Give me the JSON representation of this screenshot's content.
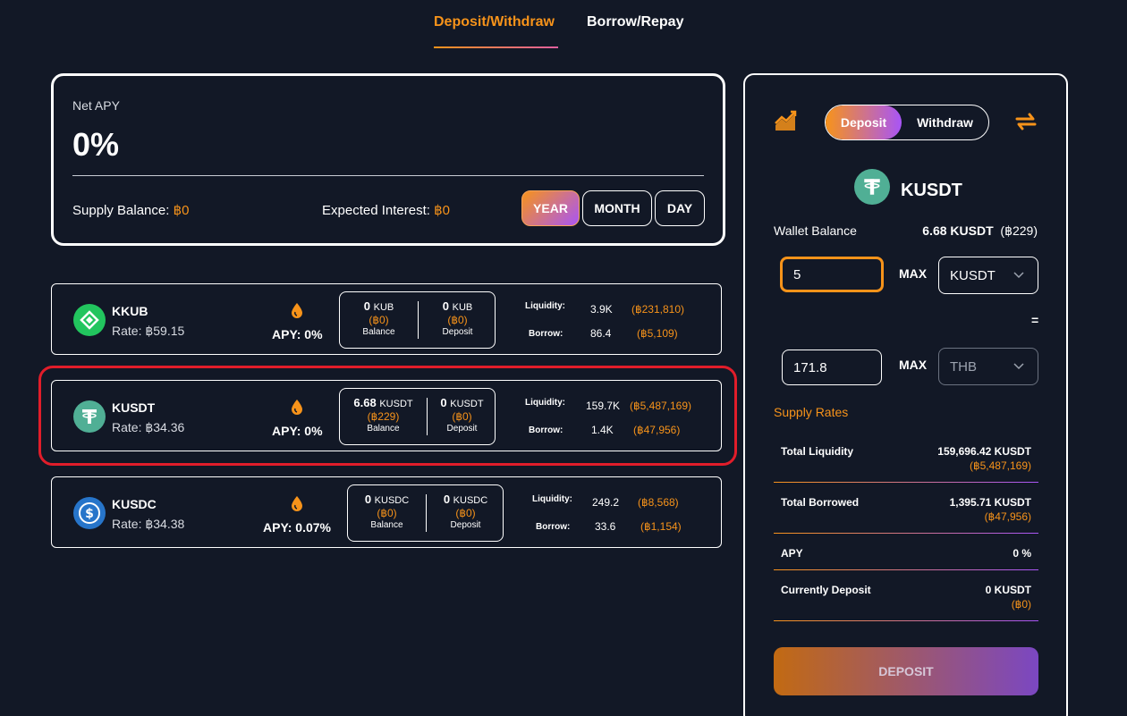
{
  "tabs": {
    "deposit_withdraw": "Deposit/Withdraw",
    "borrow_repay": "Borrow/Repay"
  },
  "summary": {
    "net_apy_label": "Net APY",
    "net_apy_value": "0%",
    "supply_balance_label": "Supply Balance: ",
    "supply_balance_value": "฿0",
    "expected_interest_label": "Expected Interest: ",
    "expected_interest_value": "฿0",
    "periods": [
      "YEAR",
      "MONTH",
      "DAY"
    ]
  },
  "assets": [
    {
      "name": "KKUB",
      "rate": "Rate: ฿59.15",
      "apy": "APY: 0%",
      "balance": "0",
      "balance_unit": "KUB",
      "balance_thb": "(฿0)",
      "balance_label": "Balance",
      "deposit": "0",
      "deposit_unit": "KUB",
      "deposit_thb": "(฿0)",
      "deposit_label": "Deposit",
      "liquidity_label": "Liquidity:",
      "liquidity": "3.9K",
      "liquidity_thb": "(฿231,810)",
      "borrow_label": "Borrow:",
      "borrow": "86.4",
      "borrow_thb": "(฿5,109)"
    },
    {
      "name": "KUSDT",
      "rate": "Rate: ฿34.36",
      "apy": "APY: 0%",
      "balance": "6.68",
      "balance_unit": "KUSDT",
      "balance_thb": "(฿229)",
      "balance_label": "Balance",
      "deposit": "0",
      "deposit_unit": "KUSDT",
      "deposit_thb": "(฿0)",
      "deposit_label": "Deposit",
      "liquidity_label": "Liquidity:",
      "liquidity": "159.7K",
      "liquidity_thb": "(฿5,487,169)",
      "borrow_label": "Borrow:",
      "borrow": "1.4K",
      "borrow_thb": "(฿47,956)"
    },
    {
      "name": "KUSDC",
      "rate": "Rate: ฿34.38",
      "apy": "APY: 0.07%",
      "balance": "0",
      "balance_unit": "KUSDC",
      "balance_thb": "(฿0)",
      "balance_label": "Balance",
      "deposit": "0",
      "deposit_unit": "KUSDC",
      "deposit_thb": "(฿0)",
      "deposit_label": "Deposit",
      "liquidity_label": "Liquidity:",
      "liquidity": "249.2",
      "liquidity_thb": "(฿8,568)",
      "borrow_label": "Borrow:",
      "borrow": "33.6",
      "borrow_thb": "(฿1,154)"
    }
  ],
  "panel": {
    "toggle_deposit": "Deposit",
    "toggle_withdraw": "Withdraw",
    "token": "KUSDT",
    "wallet_balance_label": "Wallet Balance",
    "wallet_balance_value": "6.68 KUSDT",
    "wallet_balance_thb": "(฿229)",
    "amount_input": "5",
    "max_label": "MAX",
    "token_select": "KUSDT",
    "equals": "=",
    "thb_input": "171.8",
    "currency_select": "THB",
    "supply_rates_label": "Supply Rates",
    "stats": [
      {
        "label": "Total Liquidity",
        "value": "159,696.42 KUSDT",
        "thb": "(฿5,487,169)"
      },
      {
        "label": "Total Borrowed",
        "value": "1,395.71 KUSDT",
        "thb": "(฿47,956)"
      },
      {
        "label": "APY",
        "value": "0 %",
        "thb": ""
      },
      {
        "label": "Currently Deposit",
        "value": "0 KUSDT",
        "thb": "(฿0)"
      }
    ],
    "deposit_button": "DEPOSIT"
  },
  "colors": {
    "background": "#121826",
    "accent": "#f7931a",
    "accent2": "#a855f7",
    "highlight": "#e11d2a",
    "tether": "#50af95",
    "usdc": "#2775ca",
    "kkub": "#22c55e"
  }
}
